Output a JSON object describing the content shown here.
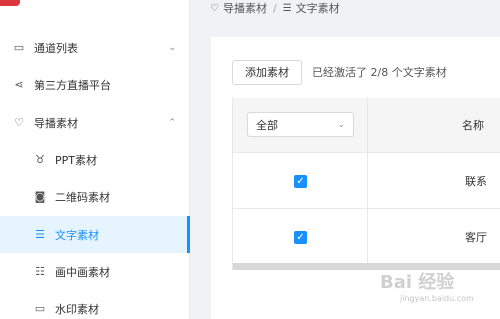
{
  "sidebar": {
    "items": [
      {
        "icon": "monitor-icon",
        "glyph": "▭",
        "label": "通道列表",
        "chevron": "⌄"
      },
      {
        "icon": "share-icon",
        "glyph": "⋖",
        "label": "第三方直播平台"
      },
      {
        "icon": "heart-icon",
        "glyph": "♡",
        "label": "导播素材",
        "chevron": "⌃"
      },
      {
        "icon": "ppt-icon",
        "glyph": "♉",
        "label": "PPT素材"
      },
      {
        "icon": "camera-icon",
        "glyph": "◙",
        "label": "二维码素材"
      },
      {
        "icon": "text-doc-icon",
        "glyph": "☰",
        "label": "文字素材"
      },
      {
        "icon": "list-icon",
        "glyph": "☷",
        "label": "画中画素材"
      },
      {
        "icon": "watermark-icon",
        "glyph": "▭",
        "label": "水印素材"
      }
    ]
  },
  "breadcrumb": {
    "parent": "导播素材",
    "parent_glyph": "♡",
    "current": "文字素材",
    "current_glyph": "☰",
    "separator": "/"
  },
  "toolbar": {
    "add_label": "添加素材",
    "activated_text": "已经激活了 2/8 个文字素材"
  },
  "table": {
    "filter_value": "全部",
    "filter_caret": "⌄",
    "header_name": "名称",
    "rows": [
      {
        "checked": "✓",
        "name": "联系"
      },
      {
        "checked": "✓",
        "name": "客厅"
      }
    ]
  },
  "watermark": {
    "main": "Bai 经验",
    "sub": "jingyan.baidu.com"
  },
  "colors": {
    "accent": "#1890ff",
    "active_bg": "#e6f4ff",
    "brand_red": "#d9363e"
  }
}
